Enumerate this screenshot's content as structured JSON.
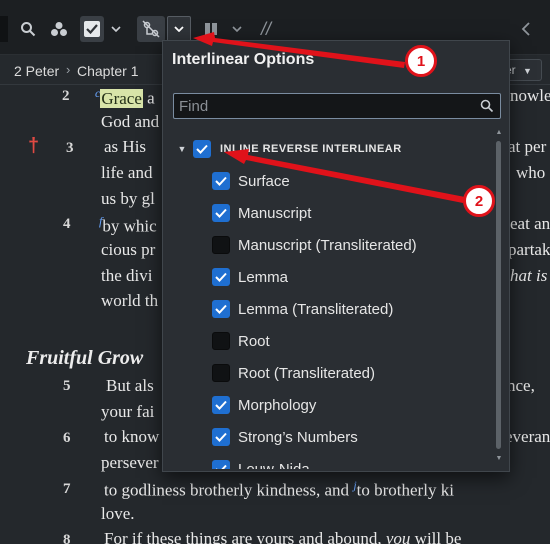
{
  "toolbar": {
    "icons": [
      "search-icon",
      "visual-filter-icon",
      "checklist-icon",
      "chevron-down-icon",
      "interlinear-icon",
      "chevron-down-icon",
      "layout-icon",
      "chevron-down-icon",
      "parallel-icon",
      "back-icon"
    ],
    "slashes": "//"
  },
  "breadcrumb": {
    "book": "2 Peter",
    "chapter": "Chapter 1",
    "filter_label": "er"
  },
  "reader": {
    "v2": {
      "num": "2",
      "fn": "c",
      "hl": "Grace",
      "rest": " a",
      "right": "nowle",
      "line2": "God and"
    },
    "v3": {
      "num": "3",
      "line1": "as His",
      "right1": "at per",
      "line2": "life and",
      "right2": "who",
      "line3": "us by gl",
      "dagger": "†"
    },
    "v4": {
      "num": "4",
      "fn": "f",
      "line1": "by whic",
      "right1": "eat an",
      "line2": "cious pr",
      "right2": "partak",
      "line3": "the divi",
      "right3": "hat is",
      "line4": "world th"
    },
    "heading": "Fruitful Grow",
    "v5": {
      "num": "5",
      "line1": "But als",
      "right1": "nce,",
      "line2": "your fai"
    },
    "v6": {
      "num": "6",
      "line1": "to know",
      "right1": "everan",
      "line2": "persever"
    },
    "v7": {
      "num": "7",
      "line1": "to godliness brotherly kindness, and",
      "fn": "j",
      "line1b": "to brotherly ki",
      "line2": "love."
    },
    "v8": {
      "num": "8",
      "line1": "For if these things are yours and abound,",
      "italic": "you",
      "line1b": " will be"
    }
  },
  "popup": {
    "title": "Interlinear Options",
    "find_placeholder": "Find",
    "group": {
      "label": "INLINE REVERSE INTERLINEAR",
      "checked": true
    },
    "options": [
      {
        "label": "Surface",
        "checked": true
      },
      {
        "label": "Manuscript",
        "checked": true
      },
      {
        "label": "Manuscript (Transliterated)",
        "checked": false
      },
      {
        "label": "Lemma",
        "checked": true
      },
      {
        "label": "Lemma (Transliterated)",
        "checked": true
      },
      {
        "label": "Root",
        "checked": false
      },
      {
        "label": "Root (Transliterated)",
        "checked": false
      },
      {
        "label": "Morphology",
        "checked": true
      },
      {
        "label": "Strong’s Numbers",
        "checked": true
      },
      {
        "label": "Louw-Nida",
        "checked": true
      }
    ]
  },
  "annotations": {
    "badge1": "1",
    "badge2": "2",
    "color": "#e0121a"
  }
}
